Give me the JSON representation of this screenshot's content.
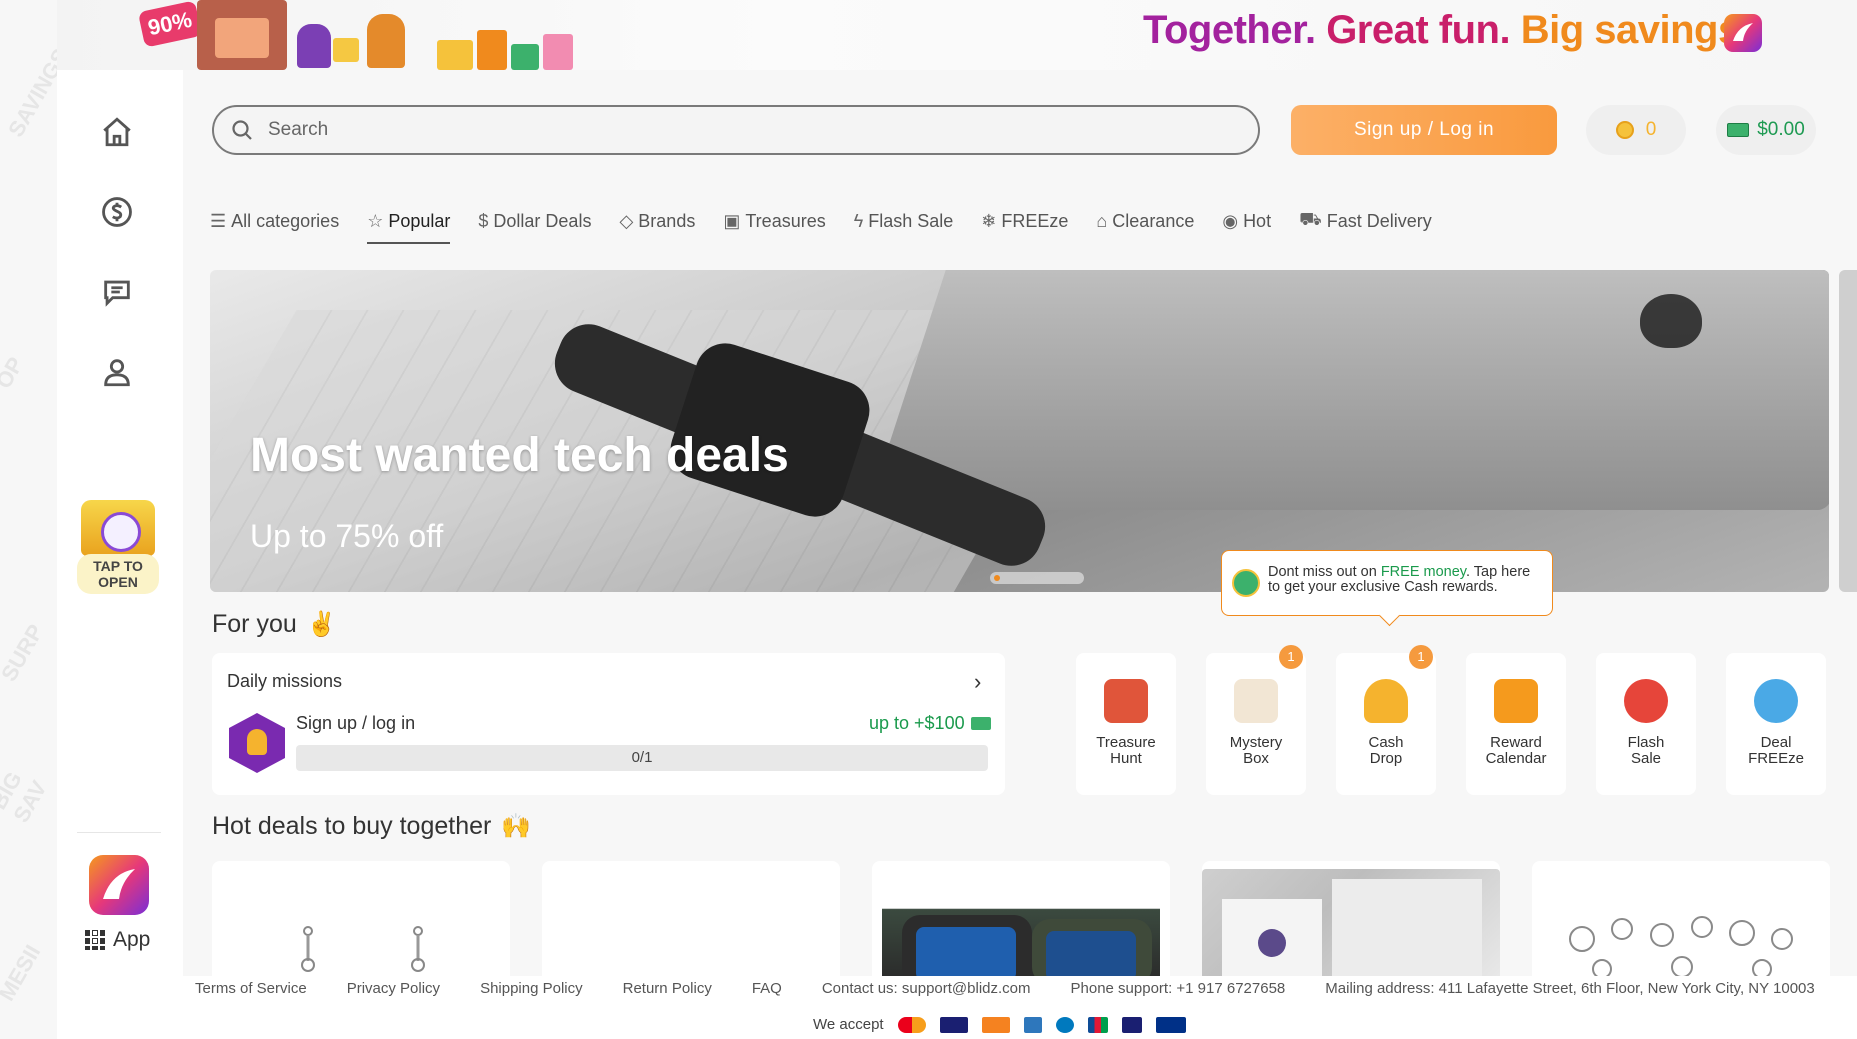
{
  "top_banner": {
    "promo_badge": "90%",
    "tagline_part1": "Together.",
    "tagline_part2": "Great fun.",
    "tagline_part3": "Big savings."
  },
  "sidebar": {
    "items": [
      {
        "icon": "home-icon"
      },
      {
        "icon": "dollar-icon"
      },
      {
        "icon": "chat-icon"
      },
      {
        "icon": "user-icon"
      }
    ],
    "tap_to_open": "TAP TO OPEN",
    "app_label": "App"
  },
  "header": {
    "search_placeholder": "Search",
    "signup_label": "Sign up / Log in",
    "coins": "0",
    "cash": "$0.00"
  },
  "categories": [
    {
      "label": "All categories",
      "icon": "menu-icon",
      "glyph": "☰"
    },
    {
      "label": "Popular",
      "icon": "star-icon",
      "glyph": "☆",
      "active": true
    },
    {
      "label": "Dollar Deals",
      "icon": "dollar-icon",
      "glyph": "$"
    },
    {
      "label": "Brands",
      "icon": "diamond-icon",
      "glyph": "◇"
    },
    {
      "label": "Treasures",
      "icon": "treasure-icon",
      "glyph": "▣"
    },
    {
      "label": "Flash Sale",
      "icon": "flash-icon",
      "glyph": "ϟ"
    },
    {
      "label": "FREEze",
      "icon": "snowflake-icon",
      "glyph": "❄"
    },
    {
      "label": "Clearance",
      "icon": "tag-icon",
      "glyph": "⌂"
    },
    {
      "label": "Hot",
      "icon": "fire-icon",
      "glyph": "◉"
    },
    {
      "label": "Fast Delivery",
      "icon": "truck-icon",
      "glyph": "⛟"
    }
  ],
  "hero": {
    "title": "Most wanted tech deals",
    "subtitle": "Up to 75% off"
  },
  "tooltip": {
    "text_before": "Dont miss out on ",
    "highlight": "FREE money",
    "text_after": ". Tap here to get your exclusive Cash rewards."
  },
  "for_you": {
    "title": "For you",
    "emoji": "✌",
    "missions": {
      "title": "Daily missions",
      "item_label": "Sign up / log in",
      "reward": "up to +$100",
      "progress_text": "0/1",
      "progress": 0
    },
    "features": [
      {
        "label_line1": "Treasure",
        "label_line2": "Hunt",
        "color": "#e0553a"
      },
      {
        "label_line1": "Mystery",
        "label_line2": "Box",
        "color": "#f2e6d4",
        "badge": "1"
      },
      {
        "label_line1": "Cash",
        "label_line2": "Drop",
        "color": "#f5b32e",
        "badge": "1"
      },
      {
        "label_line1": "Reward",
        "label_line2": "Calendar",
        "color": "#f59a1d"
      },
      {
        "label_line1": "Flash",
        "label_line2": "Sale",
        "color": "#e6453a"
      },
      {
        "label_line1": "Deal",
        "label_line2": "FREEze",
        "color": "#4aa9e6"
      }
    ]
  },
  "hot_deals": {
    "title": "Hot deals to buy together",
    "emoji": "🙌"
  },
  "footer": {
    "links": [
      "Terms of Service",
      "Privacy Policy",
      "Shipping Policy",
      "Return Policy",
      "FAQ",
      "Contact us: support@blidz.com",
      "Phone support: +1 917 6727658",
      "Mailing address: 411 Lafayette Street, 6th Floor, New York City, NY 10003"
    ],
    "accept_label": "We accept",
    "payment_methods": [
      "mastercard-icon",
      "visa-icon",
      "discover-icon",
      "amex-icon",
      "diners-icon",
      "jcb-icon",
      "unionpay-icon",
      "paypal-icon"
    ]
  }
}
